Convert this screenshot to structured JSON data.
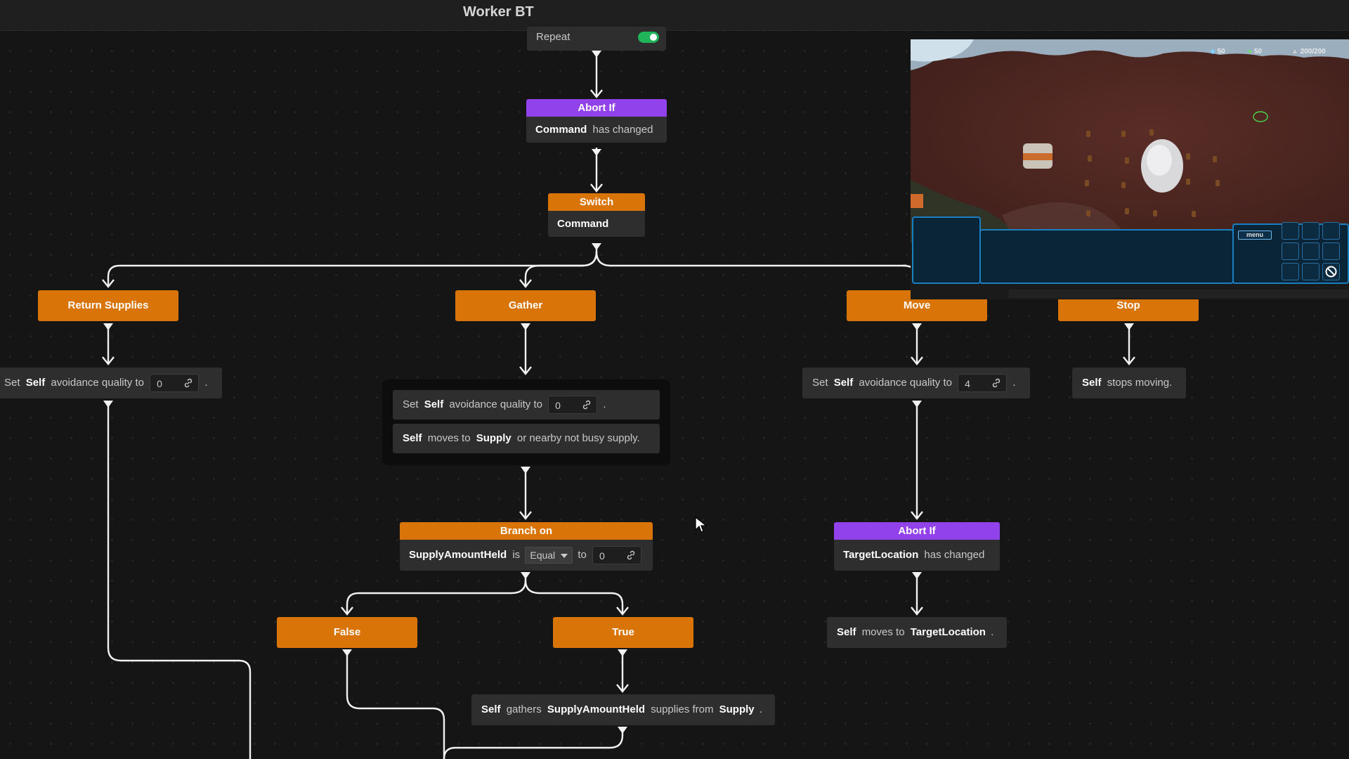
{
  "app": {
    "title": "Worker BT"
  },
  "repeat": {
    "label": "Repeat",
    "enabled": true
  },
  "abort_if_command": {
    "header": "Abort If",
    "subject": "Command",
    "condition": "has changed"
  },
  "switch": {
    "header": "Switch",
    "subject": "Command"
  },
  "branches": {
    "return_supplies": "Return Supplies",
    "gather": "Gather",
    "move": "Move",
    "stop": "Stop"
  },
  "return_supplies_action": {
    "prefix": "Set",
    "subject": "Self",
    "text": "avoidance quality to",
    "value": "0",
    "suffix": "."
  },
  "gather_group": {
    "set_avoid": {
      "prefix": "Set",
      "subject": "Self",
      "text": "avoidance quality to",
      "value": "0",
      "suffix": "."
    },
    "moves": {
      "subject": "Self",
      "text1": "moves to",
      "target": "Supply",
      "text2": "or nearby not busy supply."
    }
  },
  "branch_on": {
    "header": "Branch on",
    "subject": "SupplyAmountHeld",
    "is": "is",
    "operator": "Equal",
    "to": "to",
    "value": "0"
  },
  "false_label": "False",
  "true_label": "True",
  "gathers_action": {
    "subject": "Self",
    "text1": "gathers",
    "amount": "SupplyAmountHeld",
    "text2": "supplies from",
    "target": "Supply",
    "suffix": "."
  },
  "move_action": {
    "prefix": "Set",
    "subject": "Self",
    "text": "avoidance quality to",
    "value": "4",
    "suffix": "."
  },
  "abort_if_target": {
    "header": "Abort If",
    "subject": "TargetLocation",
    "condition": "has changed"
  },
  "moves_to_target": {
    "subject": "Self",
    "text1": "moves to",
    "target": "TargetLocation",
    "suffix": "."
  },
  "stop_action": {
    "subject": "Self",
    "text": "stops moving."
  },
  "game_preview": {
    "minerals": "50",
    "gas": "50",
    "supply": "200/200",
    "menu_label": "menu"
  },
  "colors": {
    "composite": "#d97408",
    "decorator": "#9142ea",
    "toggle_on": "#1fb35a",
    "hud_border": "#1a7fc0"
  }
}
